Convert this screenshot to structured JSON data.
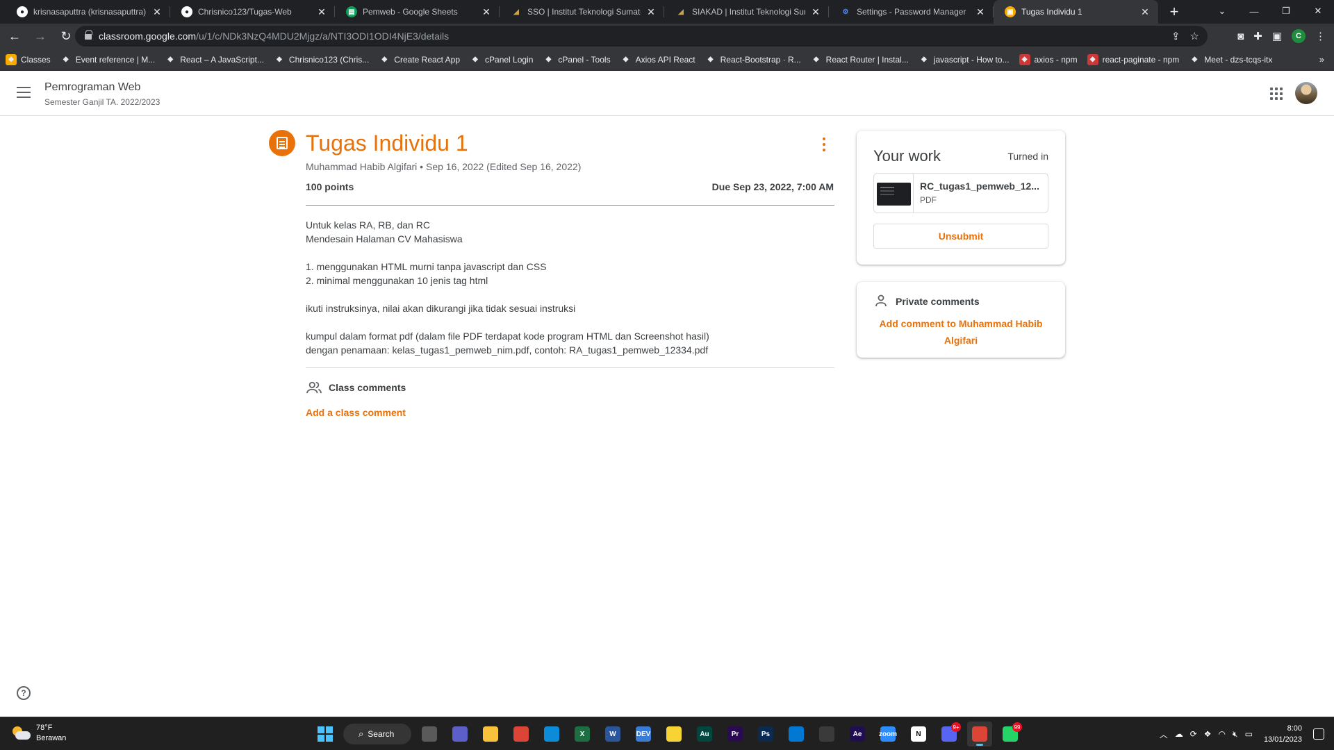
{
  "browser": {
    "tabs": [
      {
        "title": "krisnasaputtra (krisnasaputtra) / ...",
        "icon": "github-icon",
        "active": false
      },
      {
        "title": "Chrisnico123/Tugas-Web",
        "icon": "github-icon",
        "active": false
      },
      {
        "title": "Pemweb - Google Sheets",
        "icon": "sheets-icon",
        "active": false
      },
      {
        "title": "SSO | Institut Teknologi Sumatera",
        "icon": "itera-icon",
        "active": false
      },
      {
        "title": "SIAKAD | Institut Teknologi Sumatera",
        "icon": "itera-icon",
        "active": false
      },
      {
        "title": "Settings - Password Manager",
        "icon": "settings-gear-icon",
        "active": false
      },
      {
        "title": "Tugas Individu 1",
        "icon": "classroom-icon",
        "active": true
      }
    ],
    "tab_close_glyph": "✕",
    "new_tab_glyph": "+",
    "url_host": "classroom.google.com",
    "url_path": "/u/1/c/NDk3NzQ4MDU2Mjgz/a/NTI3ODI1ODI4NjE3/details",
    "profile_letter": "C",
    "bookmarks": [
      {
        "label": "Classes",
        "icon": "classroom-icon",
        "color": "#f9ab00"
      },
      {
        "label": "Event reference | M...",
        "icon": "mdn-icon",
        "color": "#35363a"
      },
      {
        "label": "React – A JavaScript...",
        "icon": "react-icon",
        "color": "#35363a"
      },
      {
        "label": "Chrisnico123 (Chris...",
        "icon": "github-icon",
        "color": "#35363a"
      },
      {
        "label": "Create React App",
        "icon": "react-icon",
        "color": "#35363a"
      },
      {
        "label": "cPanel Login",
        "icon": "cpanel-icon",
        "color": "#35363a"
      },
      {
        "label": "cPanel - Tools",
        "icon": "cpanel-icon",
        "color": "#35363a"
      },
      {
        "label": "Axios API React",
        "icon": "axios-icon",
        "color": "#35363a"
      },
      {
        "label": "React-Bootstrap · R...",
        "icon": "react-bootstrap-icon",
        "color": "#35363a"
      },
      {
        "label": "React Router | Instal...",
        "icon": "react-router-icon",
        "color": "#35363a"
      },
      {
        "label": "javascript - How to...",
        "icon": "stackoverflow-icon",
        "color": "#35363a"
      },
      {
        "label": "axios - npm",
        "icon": "npm-icon",
        "color": "#cb3837"
      },
      {
        "label": "react-paginate - npm",
        "icon": "npm-icon",
        "color": "#cb3837"
      },
      {
        "label": "Meet - dzs-tcqs-itx",
        "icon": "meet-icon",
        "color": "#35363a"
      }
    ]
  },
  "classroom": {
    "class_name": "Pemrograman Web",
    "class_section": "Semester Ganjil TA. 2022/2023",
    "accent_color": "#e8710a"
  },
  "assignment": {
    "title": "Tugas Individu 1",
    "meta": "Muhammad Habib Algifari • Sep 16, 2022 (Edited Sep 16, 2022)",
    "points": "100 points",
    "due": "Due Sep 23, 2022, 7:00 AM",
    "description": [
      "Untuk kelas RA, RB, dan RC",
      "Mendesain Halaman CV Mahasiswa",
      "",
      "1. menggunakan HTML murni tanpa javascript dan CSS",
      "2. minimal menggunakan 10 jenis tag html",
      "",
      "ikuti instruksinya, nilai akan dikurangi jika tidak sesuai instruksi",
      "",
      "kumpul dalam format pdf  (dalam file PDF terdapat kode program HTML dan Screenshot hasil)",
      "dengan penamaan: kelas_tugas1_pemweb_nim.pdf, contoh: RA_tugas1_pemweb_12334.pdf"
    ],
    "class_comments_label": "Class comments",
    "add_class_comment": "Add a class comment"
  },
  "your_work": {
    "title": "Your work",
    "status": "Turned in",
    "file_name": "RC_tugas1_pemweb_12...",
    "file_type": "PDF",
    "unsubmit_label": "Unsubmit"
  },
  "private_comments": {
    "label": "Private comments",
    "add_label": "Add comment to Muhammad Habib Algifari"
  },
  "taskbar": {
    "weather_temp": "78°F",
    "weather_desc": "Berawan",
    "search_label": "Search",
    "apps": [
      {
        "name": "task-view",
        "color": "#5a5a5a",
        "glyph": ""
      },
      {
        "name": "teams",
        "color": "#5b5fc7",
        "glyph": ""
      },
      {
        "name": "file-explorer",
        "color": "#f8c33a",
        "glyph": ""
      },
      {
        "name": "chrome",
        "color": "#db4437",
        "glyph": ""
      },
      {
        "name": "edge",
        "color": "#0c8bd8",
        "glyph": ""
      },
      {
        "name": "excel",
        "color": "#1d6f42",
        "glyph": "X"
      },
      {
        "name": "word",
        "color": "#2b579a",
        "glyph": "W"
      },
      {
        "name": "dev",
        "color": "#3a7bd5",
        "glyph": "DEV"
      },
      {
        "name": "sticky-notes",
        "color": "#f7d433",
        "glyph": ""
      },
      {
        "name": "audition",
        "color": "#00473f",
        "glyph": "Au"
      },
      {
        "name": "premiere",
        "color": "#2a0a50",
        "glyph": "Pr"
      },
      {
        "name": "photoshop",
        "color": "#0a2a50",
        "glyph": "Ps"
      },
      {
        "name": "vscode",
        "color": "#0078d4",
        "glyph": ""
      },
      {
        "name": "obs",
        "color": "#3a3a3a",
        "glyph": ""
      },
      {
        "name": "after-effects",
        "color": "#1f0f50",
        "glyph": "Ae"
      },
      {
        "name": "zoom",
        "color": "#2d8cff",
        "glyph": "zoom"
      },
      {
        "name": "notion",
        "color": "#ffffff",
        "glyph": "N"
      },
      {
        "name": "discord",
        "color": "#5865f2",
        "glyph": "",
        "badge": "9+"
      },
      {
        "name": "chrome-profile",
        "color": "#db4437",
        "glyph": "",
        "active": true
      },
      {
        "name": "whatsapp",
        "color": "#25d366",
        "glyph": "",
        "badge": "99"
      }
    ],
    "time": "8:00",
    "date": "13/01/2023"
  }
}
